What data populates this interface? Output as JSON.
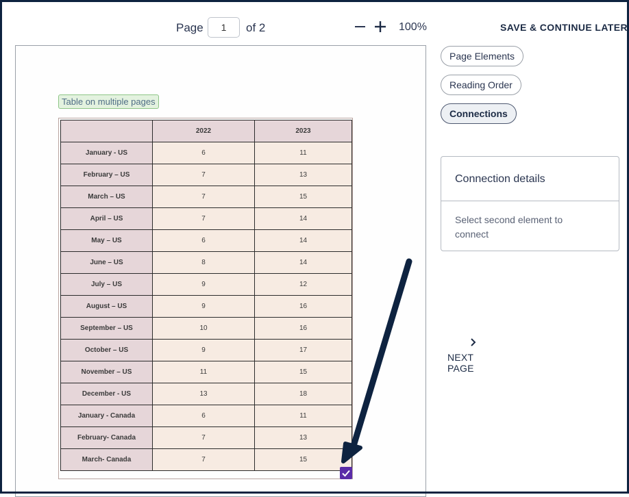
{
  "toolbar": {
    "page_label": "Page",
    "current_page": "1",
    "of_total": "of 2",
    "zoom_level": "100%",
    "save_later": "SAVE & CONTINUE LATER",
    "zoom_out_icon": "minus-icon",
    "zoom_in_icon": "plus-icon"
  },
  "document": {
    "region_tag": "Table on multiple pages",
    "table": {
      "headers": [
        "",
        "2022",
        "2023"
      ],
      "rows": [
        [
          "January - US",
          "6",
          "11"
        ],
        [
          "February – US",
          "7",
          "13"
        ],
        [
          "March – US",
          "7",
          "15"
        ],
        [
          "April – US",
          "7",
          "14"
        ],
        [
          "May – US",
          "6",
          "14"
        ],
        [
          "June – US",
          "8",
          "14"
        ],
        [
          "July – US",
          "9",
          "12"
        ],
        [
          "August – US",
          "9",
          "16"
        ],
        [
          "September – US",
          "10",
          "16"
        ],
        [
          "October – US",
          "9",
          "17"
        ],
        [
          "November – US",
          "11",
          "15"
        ],
        [
          "December - US",
          "13",
          "18"
        ],
        [
          "January - Canada",
          "6",
          "11"
        ],
        [
          "February- Canada",
          "7",
          "13"
        ],
        [
          "March- Canada",
          "7",
          "15"
        ]
      ]
    },
    "checkbox_checked": true
  },
  "panel": {
    "modes": [
      "Page Elements",
      "Reading Order",
      "Connections"
    ],
    "active_mode": "Connections",
    "details_title": "Connection details",
    "details_body": "Select second element to connect",
    "next_page": "NEXT PAGE"
  },
  "colors": {
    "frame": "#0e2340",
    "arrow": "#0e2340",
    "checkbox": "#5a2ca8",
    "header_cell": "#e6d6d9",
    "value_cell": "#f7ebe2",
    "region_tag_bg": "#e3f2df"
  }
}
